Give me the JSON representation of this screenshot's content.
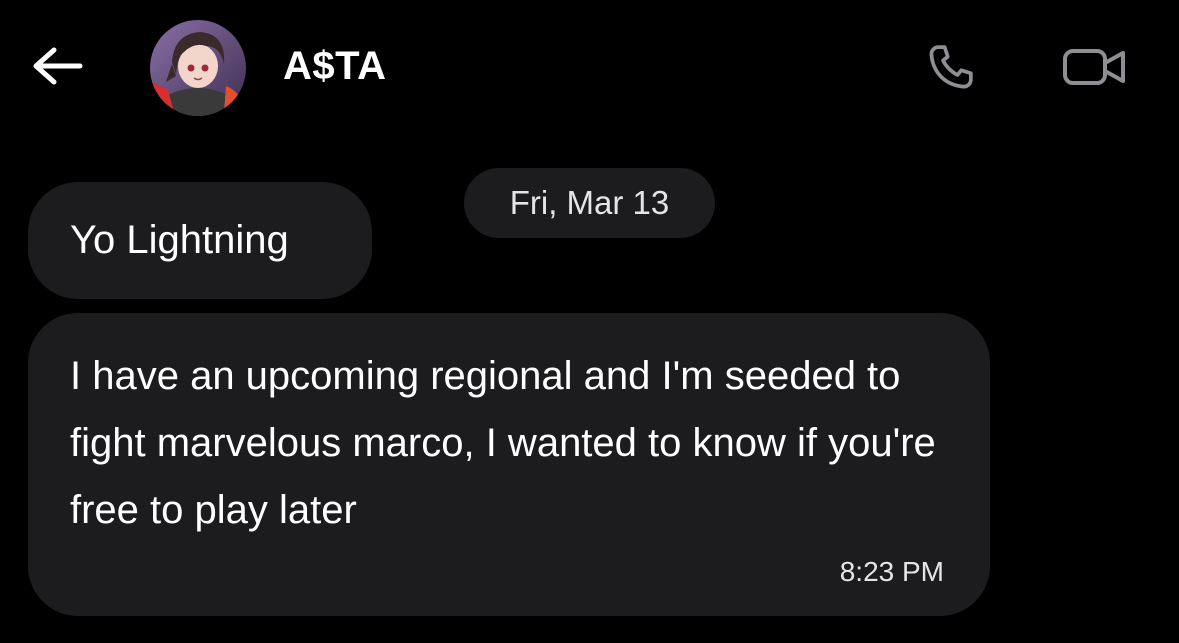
{
  "header": {
    "back_icon": "arrow-left-icon",
    "contact_name": "A$TA",
    "call_icon": "phone-icon",
    "video_icon": "video-camera-icon"
  },
  "conversation": {
    "date_divider": "Fri, Mar 13",
    "messages": [
      {
        "text": "Yo Lightning"
      },
      {
        "text": "I have an upcoming regional and I'm seeded to fight marvelous marco, I wanted to know if you're free to play later",
        "time": "8:23 PM"
      }
    ]
  },
  "colors": {
    "background": "#000000",
    "bubble": "#1c1c1e",
    "text": "#ffffff",
    "icon": "#8e8e93"
  }
}
